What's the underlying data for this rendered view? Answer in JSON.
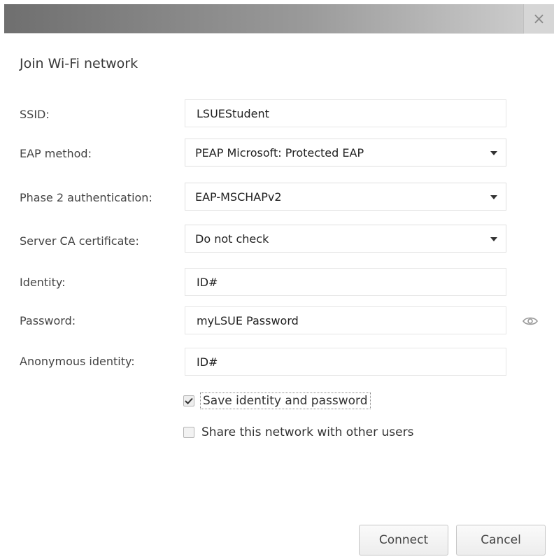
{
  "dialog": {
    "title": "Join Wi-Fi network",
    "close_glyph": "×"
  },
  "form": {
    "ssid": {
      "label": "SSID:",
      "value": "LSUEStudent"
    },
    "eap_method": {
      "label": "EAP method:",
      "value": "PEAP Microsoft: Protected EAP"
    },
    "phase2": {
      "label": "Phase 2 authentication:",
      "value": "EAP-MSCHAPv2"
    },
    "server_ca": {
      "label": "Server CA certificate:",
      "value": "Do not check"
    },
    "identity": {
      "label": "Identity:",
      "value": "ID#"
    },
    "password": {
      "label": "Password:",
      "value": "myLSUE Password"
    },
    "anonymous_identity": {
      "label": "Anonymous identity:",
      "value": "ID#"
    }
  },
  "options": {
    "save_identity": {
      "label": "Save identity and password",
      "checked": true
    },
    "share_network": {
      "label": "Share this network with other users",
      "checked": false
    }
  },
  "buttons": {
    "connect": "Connect",
    "cancel": "Cancel"
  },
  "icons": {
    "close": "close-icon",
    "dropdown": "chevron-down-icon",
    "show_password": "eye-icon",
    "check": "checkmark-icon"
  },
  "colors": {
    "titlebar_dark": "#6f6f6f",
    "titlebar_light": "#d2d2d2",
    "text": "#333333",
    "border": "#e0e0e0"
  }
}
